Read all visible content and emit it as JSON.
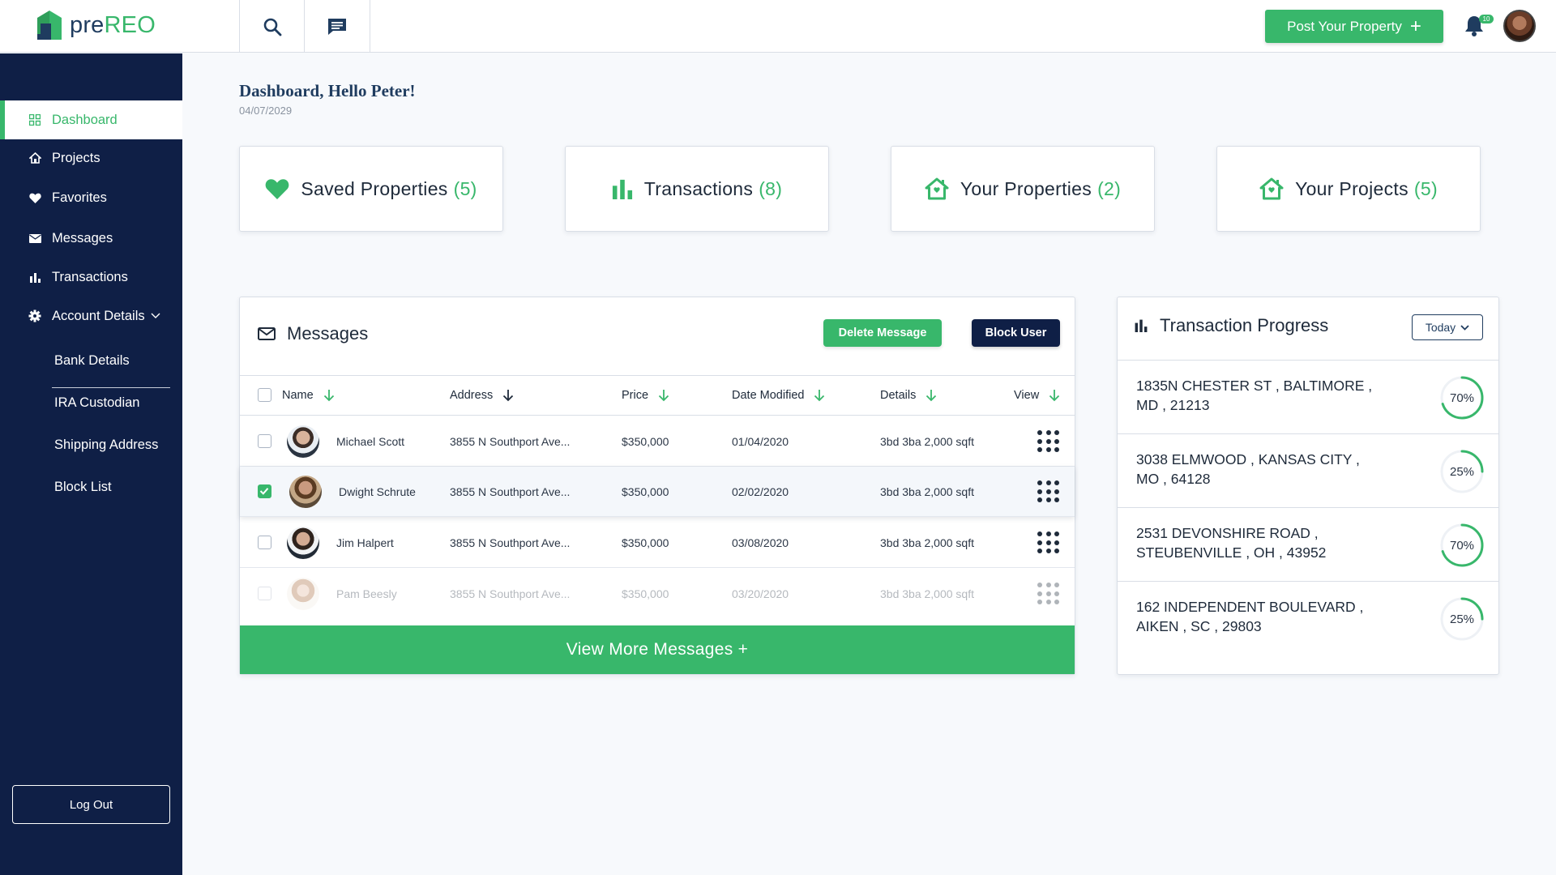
{
  "brand": {
    "pre": "pre",
    "reo": "REO"
  },
  "topbar": {
    "post_property_label": "Post Your Property",
    "notification_count": "10",
    "icons": [
      "search-icon",
      "chat-icon",
      "bell-icon"
    ]
  },
  "sidebar": {
    "items": [
      {
        "label": "Dashboard",
        "icon": "dashboard-grid-icon",
        "active": true
      },
      {
        "label": "Projects",
        "icon": "home-icon"
      },
      {
        "label": "Favorites",
        "icon": "heart-icon"
      },
      {
        "label": "Messages",
        "icon": "envelope-icon"
      },
      {
        "label": "Transactions",
        "icon": "bar-chart-icon"
      },
      {
        "label": "Account Details",
        "icon": "gear-icon"
      }
    ],
    "sub_items": [
      "Bank Details",
      "IRA Custodian",
      "Shipping Address",
      "Block List"
    ],
    "logout_label": "Log Out"
  },
  "header": {
    "greeting": "Dashboard, Hello Peter!",
    "date": "04/07/2029"
  },
  "stats": [
    {
      "label": "Saved Properties",
      "count": "(5)",
      "icon": "heart-icon"
    },
    {
      "label": "Transactions",
      "count": "(8)",
      "icon": "bar-chart-icon"
    },
    {
      "label": "Your Properties",
      "count": "(2)",
      "icon": "house-icon"
    },
    {
      "label": "Your Projects",
      "count": "(5)",
      "icon": "house-icon"
    }
  ],
  "messages": {
    "title": "Messages",
    "delete_label": "Delete Message",
    "block_label": "Block User",
    "columns": [
      "Name",
      "Address",
      "Price",
      "Date Modified",
      "Details",
      "View"
    ],
    "rows": [
      {
        "name": "Michael Scott",
        "address": "3855 N Southport Ave...",
        "price": "$350,000",
        "date": "01/04/2020",
        "details": "3bd 3ba 2,000 sqft",
        "checked": false
      },
      {
        "name": "Dwight Schrute",
        "address": "3855 N Southport Ave...",
        "price": "$350,000",
        "date": "02/02/2020",
        "details": "3bd 3ba 2,000 sqft",
        "checked": true
      },
      {
        "name": "Jim Halpert",
        "address": "3855 N Southport Ave...",
        "price": "$350,000",
        "date": "03/08/2020",
        "details": "3bd 3ba 2,000 sqft",
        "checked": false
      },
      {
        "name": "Pam Beesly",
        "address": "3855 N Southport Ave...",
        "price": "$350,000",
        "date": "03/20/2020",
        "details": "3bd 3ba 2,000 sqft",
        "checked": false
      }
    ],
    "view_more_label": "View More Messages +"
  },
  "transaction_progress": {
    "title": "Transaction Progress",
    "filter": "Today",
    "items": [
      {
        "line1": "1835N CHESTER ST , BALTIMORE ,",
        "line2": "MD , 21213",
        "percent": 70,
        "percent_label": "70%"
      },
      {
        "line1": "3038 ELMWOOD , KANSAS CITY ,",
        "line2": "MO , 64128",
        "percent": 25,
        "percent_label": "25%"
      },
      {
        "line1": "2531 DEVONSHIRE ROAD ,",
        "line2": "STEUBENVILLE , OH , 43952",
        "percent": 70,
        "percent_label": "70%"
      },
      {
        "line1": "162 INDEPENDENT BOULEVARD ,",
        "line2": "AIKEN , SC , 29803",
        "percent": 25,
        "percent_label": "25%"
      }
    ]
  },
  "colors": {
    "accent": "#38b76b",
    "navy": "#0f1f46",
    "title": "#1f3c5f"
  }
}
